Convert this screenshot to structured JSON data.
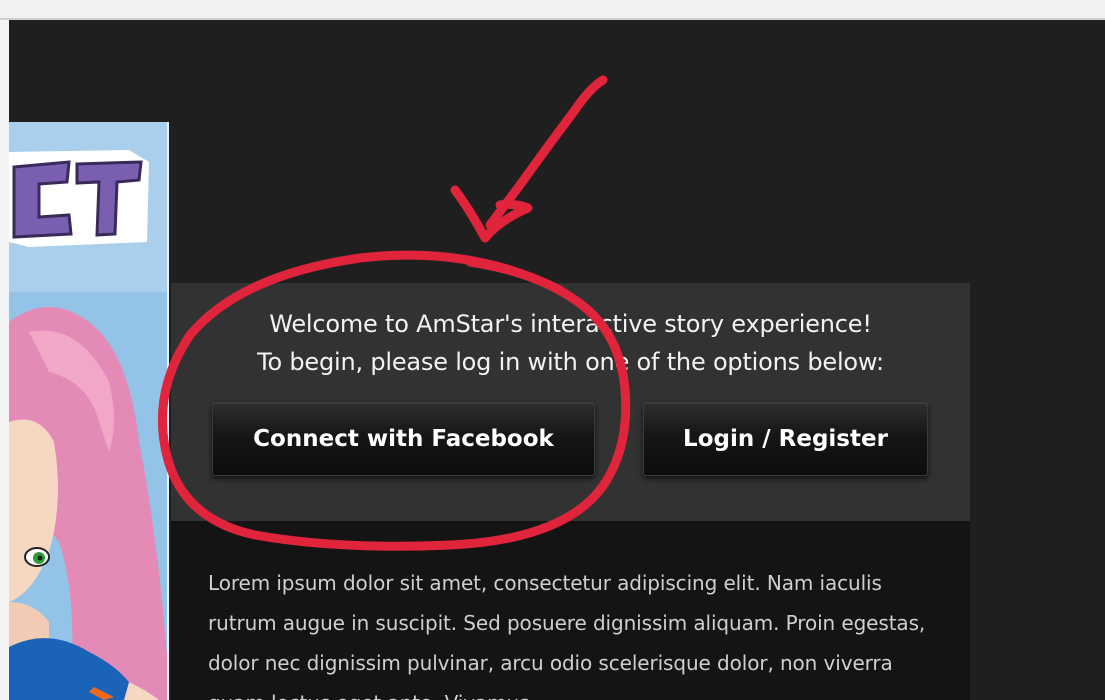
{
  "welcome": {
    "line1": "Welcome to AmStar's interactive story experience!",
    "line2": "To begin, please log in with one of the options below:"
  },
  "buttons": {
    "facebook": "Connect with Facebook",
    "login": "Login / Register"
  },
  "description": "Lorem ipsum dolor sit amet, consectetur adipiscing elit. Nam iaculis rutrum augue in suscipit. Sed posuere dignissim aliquam. Proin egestas, dolor nec dignissim pulvinar, arcu odio scelerisque dolor, non viverra quam lectus eget ante. Vivamus",
  "banner": {
    "title_fragment": "CT"
  },
  "colors": {
    "page_background": "#1f1f1f",
    "panel_background": "#323232",
    "annotation": "#e0243c"
  }
}
